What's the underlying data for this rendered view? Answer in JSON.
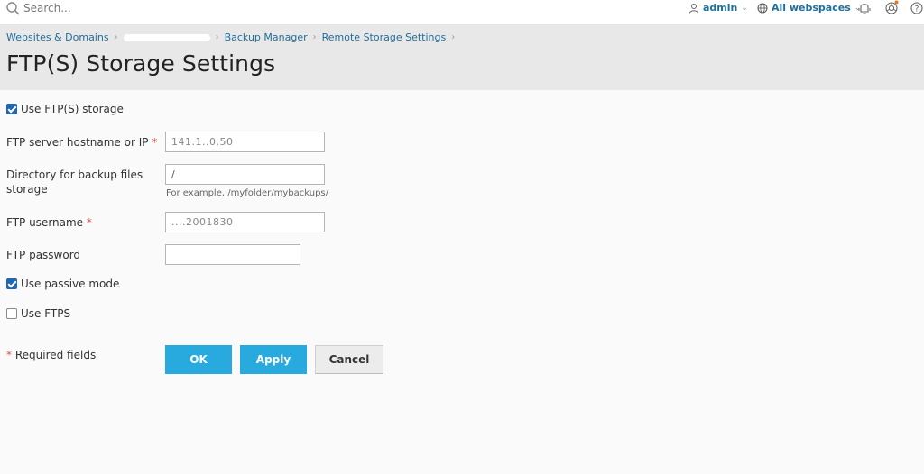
{
  "topbar": {
    "search_placeholder": "Search...",
    "user": "admin",
    "webspaces": "All webspaces"
  },
  "breadcrumb": {
    "item1": "Websites & Domains",
    "item3": "Backup Manager",
    "item4": "Remote Storage Settings"
  },
  "page_title": "FTP(S) Storage Settings",
  "form": {
    "use_ftp_label": "Use FTP(S) storage",
    "use_ftp_checked": true,
    "hostname_label": "FTP server hostname or IP",
    "hostname_value": "141.1..0.50",
    "directory_label": "Directory for backup files storage",
    "directory_value": "/",
    "directory_hint": "For example, /myfolder/mybackups/",
    "username_label": "FTP username",
    "username_value": "....2001830",
    "password_label": "FTP password",
    "password_value": "",
    "passive_label": "Use passive mode",
    "passive_checked": true,
    "ftps_label": "Use FTPS",
    "ftps_checked": false,
    "required_star": "*",
    "required_label": "Required fields"
  },
  "buttons": {
    "ok": "OK",
    "apply": "Apply",
    "cancel": "Cancel"
  },
  "colors": {
    "primary": "#28aade",
    "link": "#1f6e9c",
    "required": "#d9534f",
    "checkbox": "#1e66b6"
  }
}
